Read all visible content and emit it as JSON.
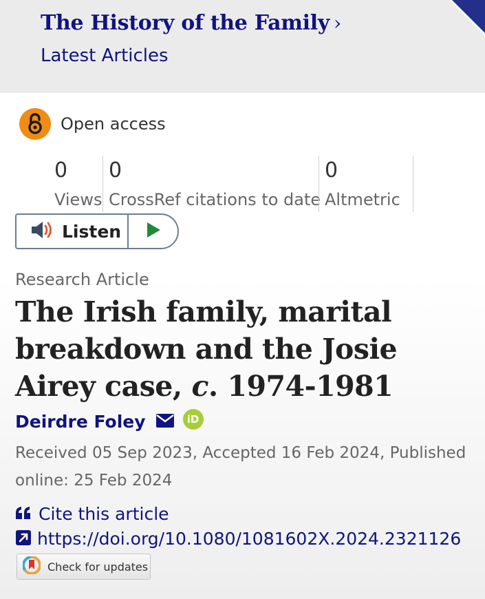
{
  "header": {
    "journal_title": "The History of the Family",
    "journal_chevron": "›",
    "section": "Latest Articles"
  },
  "access": {
    "label": "Open access",
    "icon": "open-lock-icon",
    "color": "#f08c12"
  },
  "metrics": [
    {
      "value": "0",
      "label": "Views"
    },
    {
      "value": "0",
      "label": "CrossRef citations to date"
    },
    {
      "value": "0",
      "label": "Altmetric"
    }
  ],
  "listen": {
    "label": "Listen",
    "speaker_icon": "speaker-icon",
    "play_icon": "play-icon"
  },
  "article": {
    "type": "Research Article",
    "title_main": "The Irish family, marital breakdown and the Josie Airey case,",
    "title_circa": "c",
    "title_tail": ". 1974-1981",
    "author": "Deirdre Foley",
    "orcid_label": "iD",
    "dates": "Received 05 Sep 2023, Accepted 16 Feb 2024, Published online: 25 Feb 2024"
  },
  "links": {
    "cite_label": "Cite this article",
    "doi": "https://doi.org/10.1080/1081602X.2024.2321126",
    "check_updates": "Check for updates"
  },
  "colors": {
    "brand": "#10147e",
    "header_bg": "#ebebeb",
    "orcid": "#a6ce39"
  }
}
